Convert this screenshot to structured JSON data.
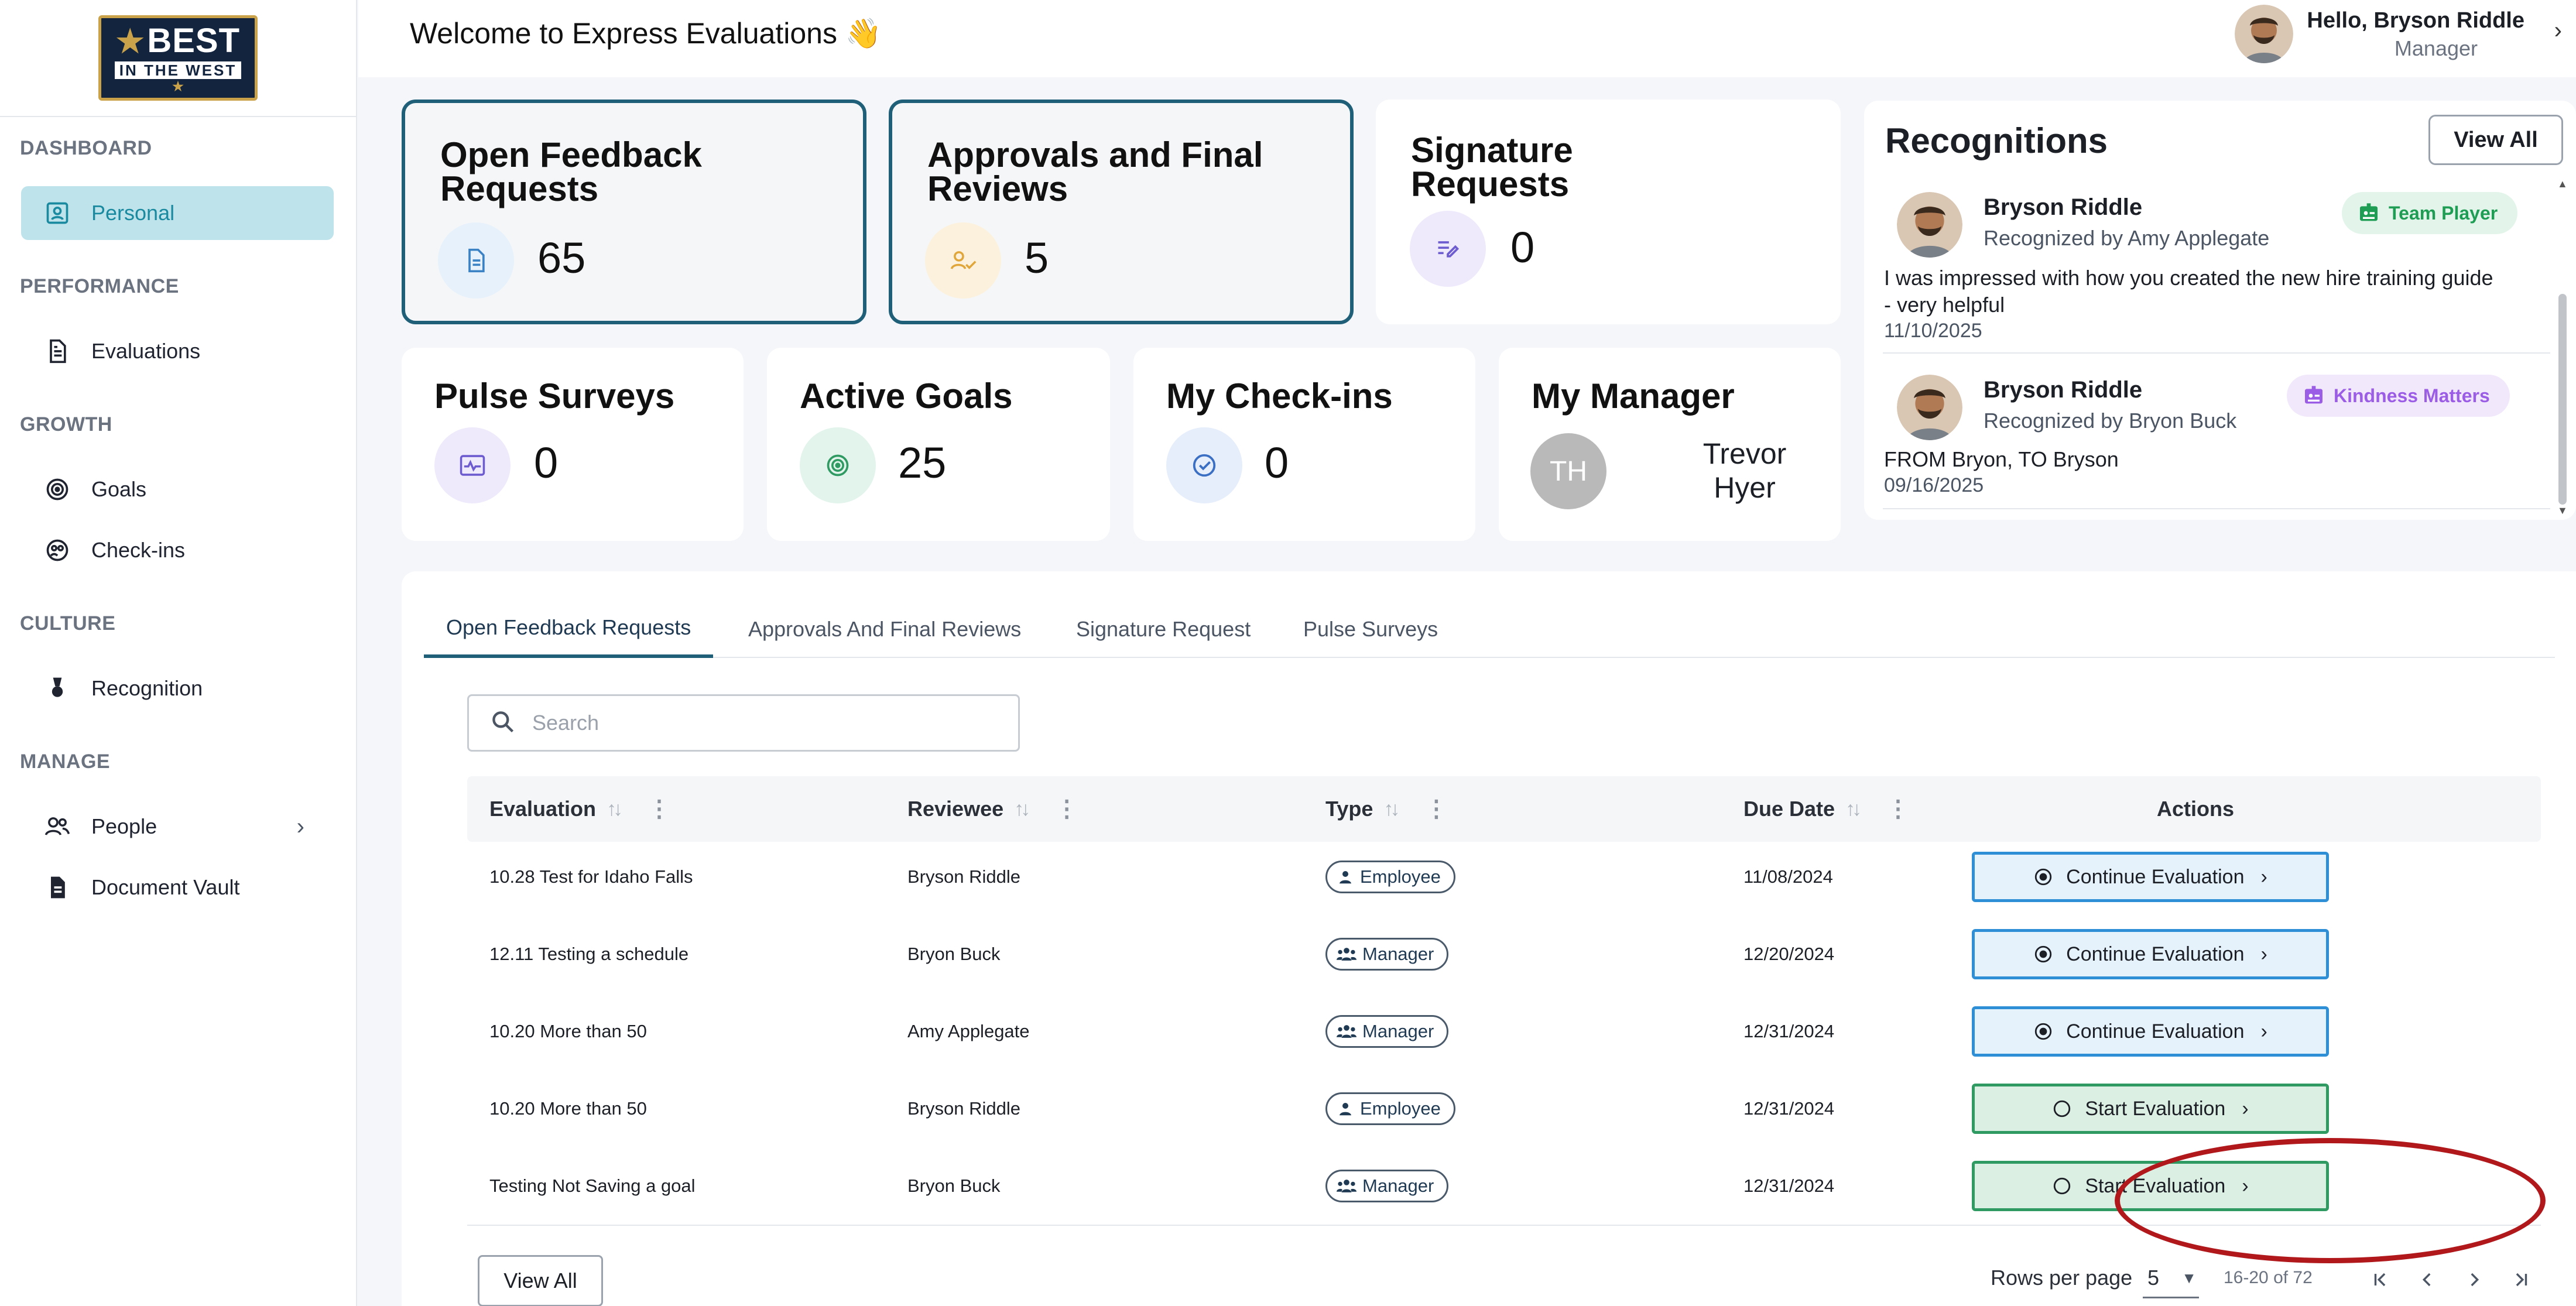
{
  "brand": {
    "logo_line1": "BEST",
    "logo_line2": "IN THE WEST"
  },
  "header": {
    "welcome": "Welcome to Express Evaluations 👋",
    "user_greeting": "Hello, Bryson Riddle",
    "user_role": "Manager"
  },
  "sidebar": {
    "sections": [
      {
        "label": "DASHBOARD",
        "items": [
          {
            "label": "Personal",
            "icon": "id-card-icon",
            "active": true
          }
        ]
      },
      {
        "label": "PERFORMANCE",
        "items": [
          {
            "label": "Evaluations",
            "icon": "document-icon"
          }
        ]
      },
      {
        "label": "GROWTH",
        "items": [
          {
            "label": "Goals",
            "icon": "target-icon"
          },
          {
            "label": "Check-ins",
            "icon": "checkin-icon"
          }
        ]
      },
      {
        "label": "CULTURE",
        "items": [
          {
            "label": "Recognition",
            "icon": "medal-icon"
          }
        ]
      },
      {
        "label": "MANAGE",
        "items": [
          {
            "label": "People",
            "icon": "people-icon",
            "expandable": true
          },
          {
            "label": "Document Vault",
            "icon": "vault-icon"
          }
        ]
      }
    ]
  },
  "cards": {
    "open_feedback": {
      "title": "Open Feedback Requests",
      "value": "65"
    },
    "approvals": {
      "title": "Approvals and Final Reviews",
      "value": "5"
    },
    "signature": {
      "title": "Signature Requests",
      "value": "0"
    },
    "pulse": {
      "title": "Pulse Surveys",
      "value": "0"
    },
    "goals": {
      "title": "Active Goals",
      "value": "25"
    },
    "checkins": {
      "title": "My Check-ins",
      "value": "0"
    },
    "manager": {
      "title": "My Manager",
      "initials": "TH",
      "name_line1": "Trevor",
      "name_line2": "Hyer"
    }
  },
  "recognitions": {
    "title": "Recognitions",
    "view_all": "View All",
    "items": [
      {
        "name": "Bryson Riddle",
        "by": "Recognized by Amy Applegate",
        "badge": "Team Player",
        "badge_color": "#1f9d55",
        "badge_bg": "#e3f5ea",
        "message": "I was impressed with how you created the new hire training guide - very helpful",
        "date": "11/10/2025"
      },
      {
        "name": "Bryson Riddle",
        "by": "Recognized by Bryon Buck",
        "badge": "Kindness Matters",
        "badge_color": "#9b5de5",
        "badge_bg": "#f1e8fb",
        "message": "FROM Bryon, TO Bryson",
        "date": "09/16/2025"
      }
    ]
  },
  "tabs": [
    "Open Feedback Requests",
    "Approvals And Final Reviews",
    "Signature Request",
    "Pulse Surveys"
  ],
  "search": {
    "placeholder": "Search"
  },
  "table": {
    "columns": [
      "Evaluation",
      "Reviewee",
      "Type",
      "Due Date",
      "Actions"
    ],
    "rows": [
      {
        "evaluation": "10.28 Test for Idaho Falls",
        "reviewee": "Bryson Riddle",
        "type": "Employee",
        "due": "11/08/2024",
        "action": "Continue Evaluation"
      },
      {
        "evaluation": "12.11 Testing a schedule",
        "reviewee": "Bryon Buck",
        "type": "Manager",
        "due": "12/20/2024",
        "action": "Continue Evaluation"
      },
      {
        "evaluation": "10.20 More than 50",
        "reviewee": "Amy Applegate",
        "type": "Manager",
        "due": "12/31/2024",
        "action": "Continue Evaluation"
      },
      {
        "evaluation": "10.20 More than 50",
        "reviewee": "Bryson Riddle",
        "type": "Employee",
        "due": "12/31/2024",
        "action": "Start Evaluation"
      },
      {
        "evaluation": "Testing Not Saving a goal",
        "reviewee": "Bryon Buck",
        "type": "Manager",
        "due": "12/31/2024",
        "action": "Start Evaluation"
      }
    ]
  },
  "footer": {
    "view_all": "View All",
    "rows_per_page_label": "Rows per page",
    "rows_per_page": "5",
    "range": "16-20 of 72"
  },
  "colors": {
    "accent": "#1f5f78",
    "active_nav_bg": "#bfe3ea",
    "continue_border": "#2f8fd6",
    "start_border": "#2f9a62",
    "highlight": "#b0181c"
  }
}
